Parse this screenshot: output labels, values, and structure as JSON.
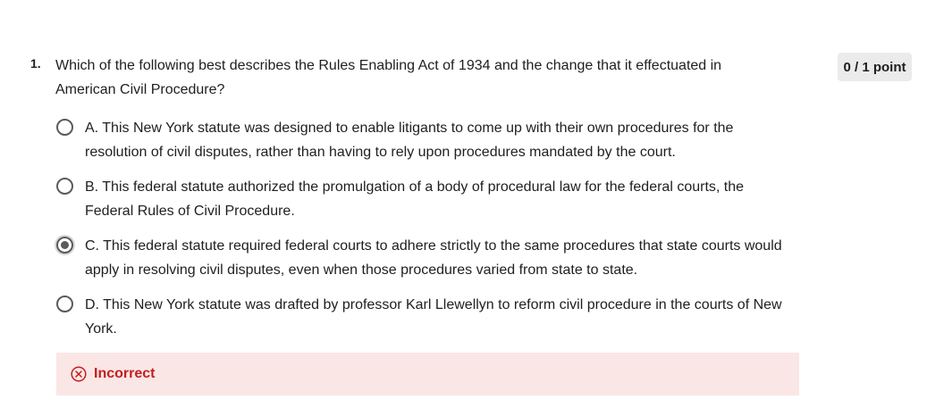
{
  "question": {
    "number": "1.",
    "text": "Which of the following best describes the Rules Enabling Act of 1934 and the change that it effectuated in American Civil Procedure?",
    "score": "0 / 1 point"
  },
  "options": [
    {
      "text": "A. This New York statute was designed to enable litigants to come up with their own procedures for the resolution of civil disputes, rather than having to rely upon procedures mandated by the court.",
      "selected": false
    },
    {
      "text": "B. This federal statute authorized the promulgation of a body of procedural law for the federal courts, the Federal Rules of Civil Procedure.",
      "selected": false
    },
    {
      "text": "C. This federal statute required federal courts to adhere strictly to the same procedures that state courts would apply in resolving civil disputes, even when those procedures varied from state to state.",
      "selected": true
    },
    {
      "text": "D. This New York statute was drafted by professor Karl Llewellyn to reform civil procedure in the courts of New York.",
      "selected": false
    }
  ],
  "feedback": {
    "label": "Incorrect",
    "icon": "x-circle-icon",
    "color": "#c21f1f",
    "background": "#fbe6e6"
  }
}
